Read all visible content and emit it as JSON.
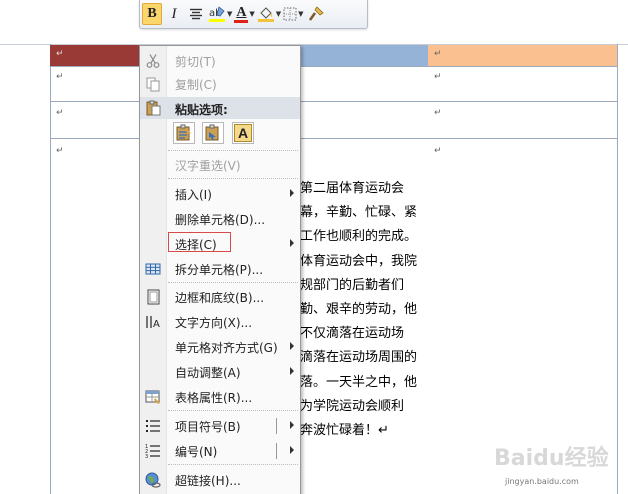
{
  "toolbar": {
    "bold_label": "B",
    "italic_label": "I",
    "font_color_letter": "A",
    "colors": {
      "highlight": "#ffff00",
      "font": "#e0211a"
    }
  },
  "document": {
    "paragraph_mark": "↵",
    "paragraph_lines": [
      "第二届体育运动会",
      "幕，辛勤、忙碌、紧",
      "工作也顺利的完成。",
      "体育运动会中，我院",
      "规部门的后勤者们",
      "勤、艰辛的劳动，他",
      "不仅滴落在运动场",
      "滴落在运动场周围的",
      "落。一天半之中，他",
      "为学院运动会顺利",
      "奔波忙碌着！↵"
    ],
    "header_colors": {
      "first": "#9a3a36",
      "middle": "#95b3d7",
      "last": "#fac090"
    }
  },
  "context_menu": {
    "cut": "剪切(T)",
    "copy": "复制(C)",
    "paste_options": "粘贴选项:",
    "paste_text_option": "A",
    "hanzi_reselect": "汉字重选(V)",
    "insert": "插入(I)",
    "delete_cells": "删除单元格(D)...",
    "select": "选择(C)",
    "split_cells": "拆分单元格(P)...",
    "borders_shading": "边框和底纹(B)...",
    "text_direction": "文字方向(X)...",
    "cell_alignment": "单元格对齐方式(G)",
    "autofit": "自动调整(A)",
    "table_properties": "表格属性(R)...",
    "bullets": "项目符号(B)",
    "numbering": "编号(N)",
    "hyperlink": "超链接(H)..."
  },
  "watermark": {
    "text": "Baidu经验",
    "url": "jingyan.baidu.com"
  }
}
